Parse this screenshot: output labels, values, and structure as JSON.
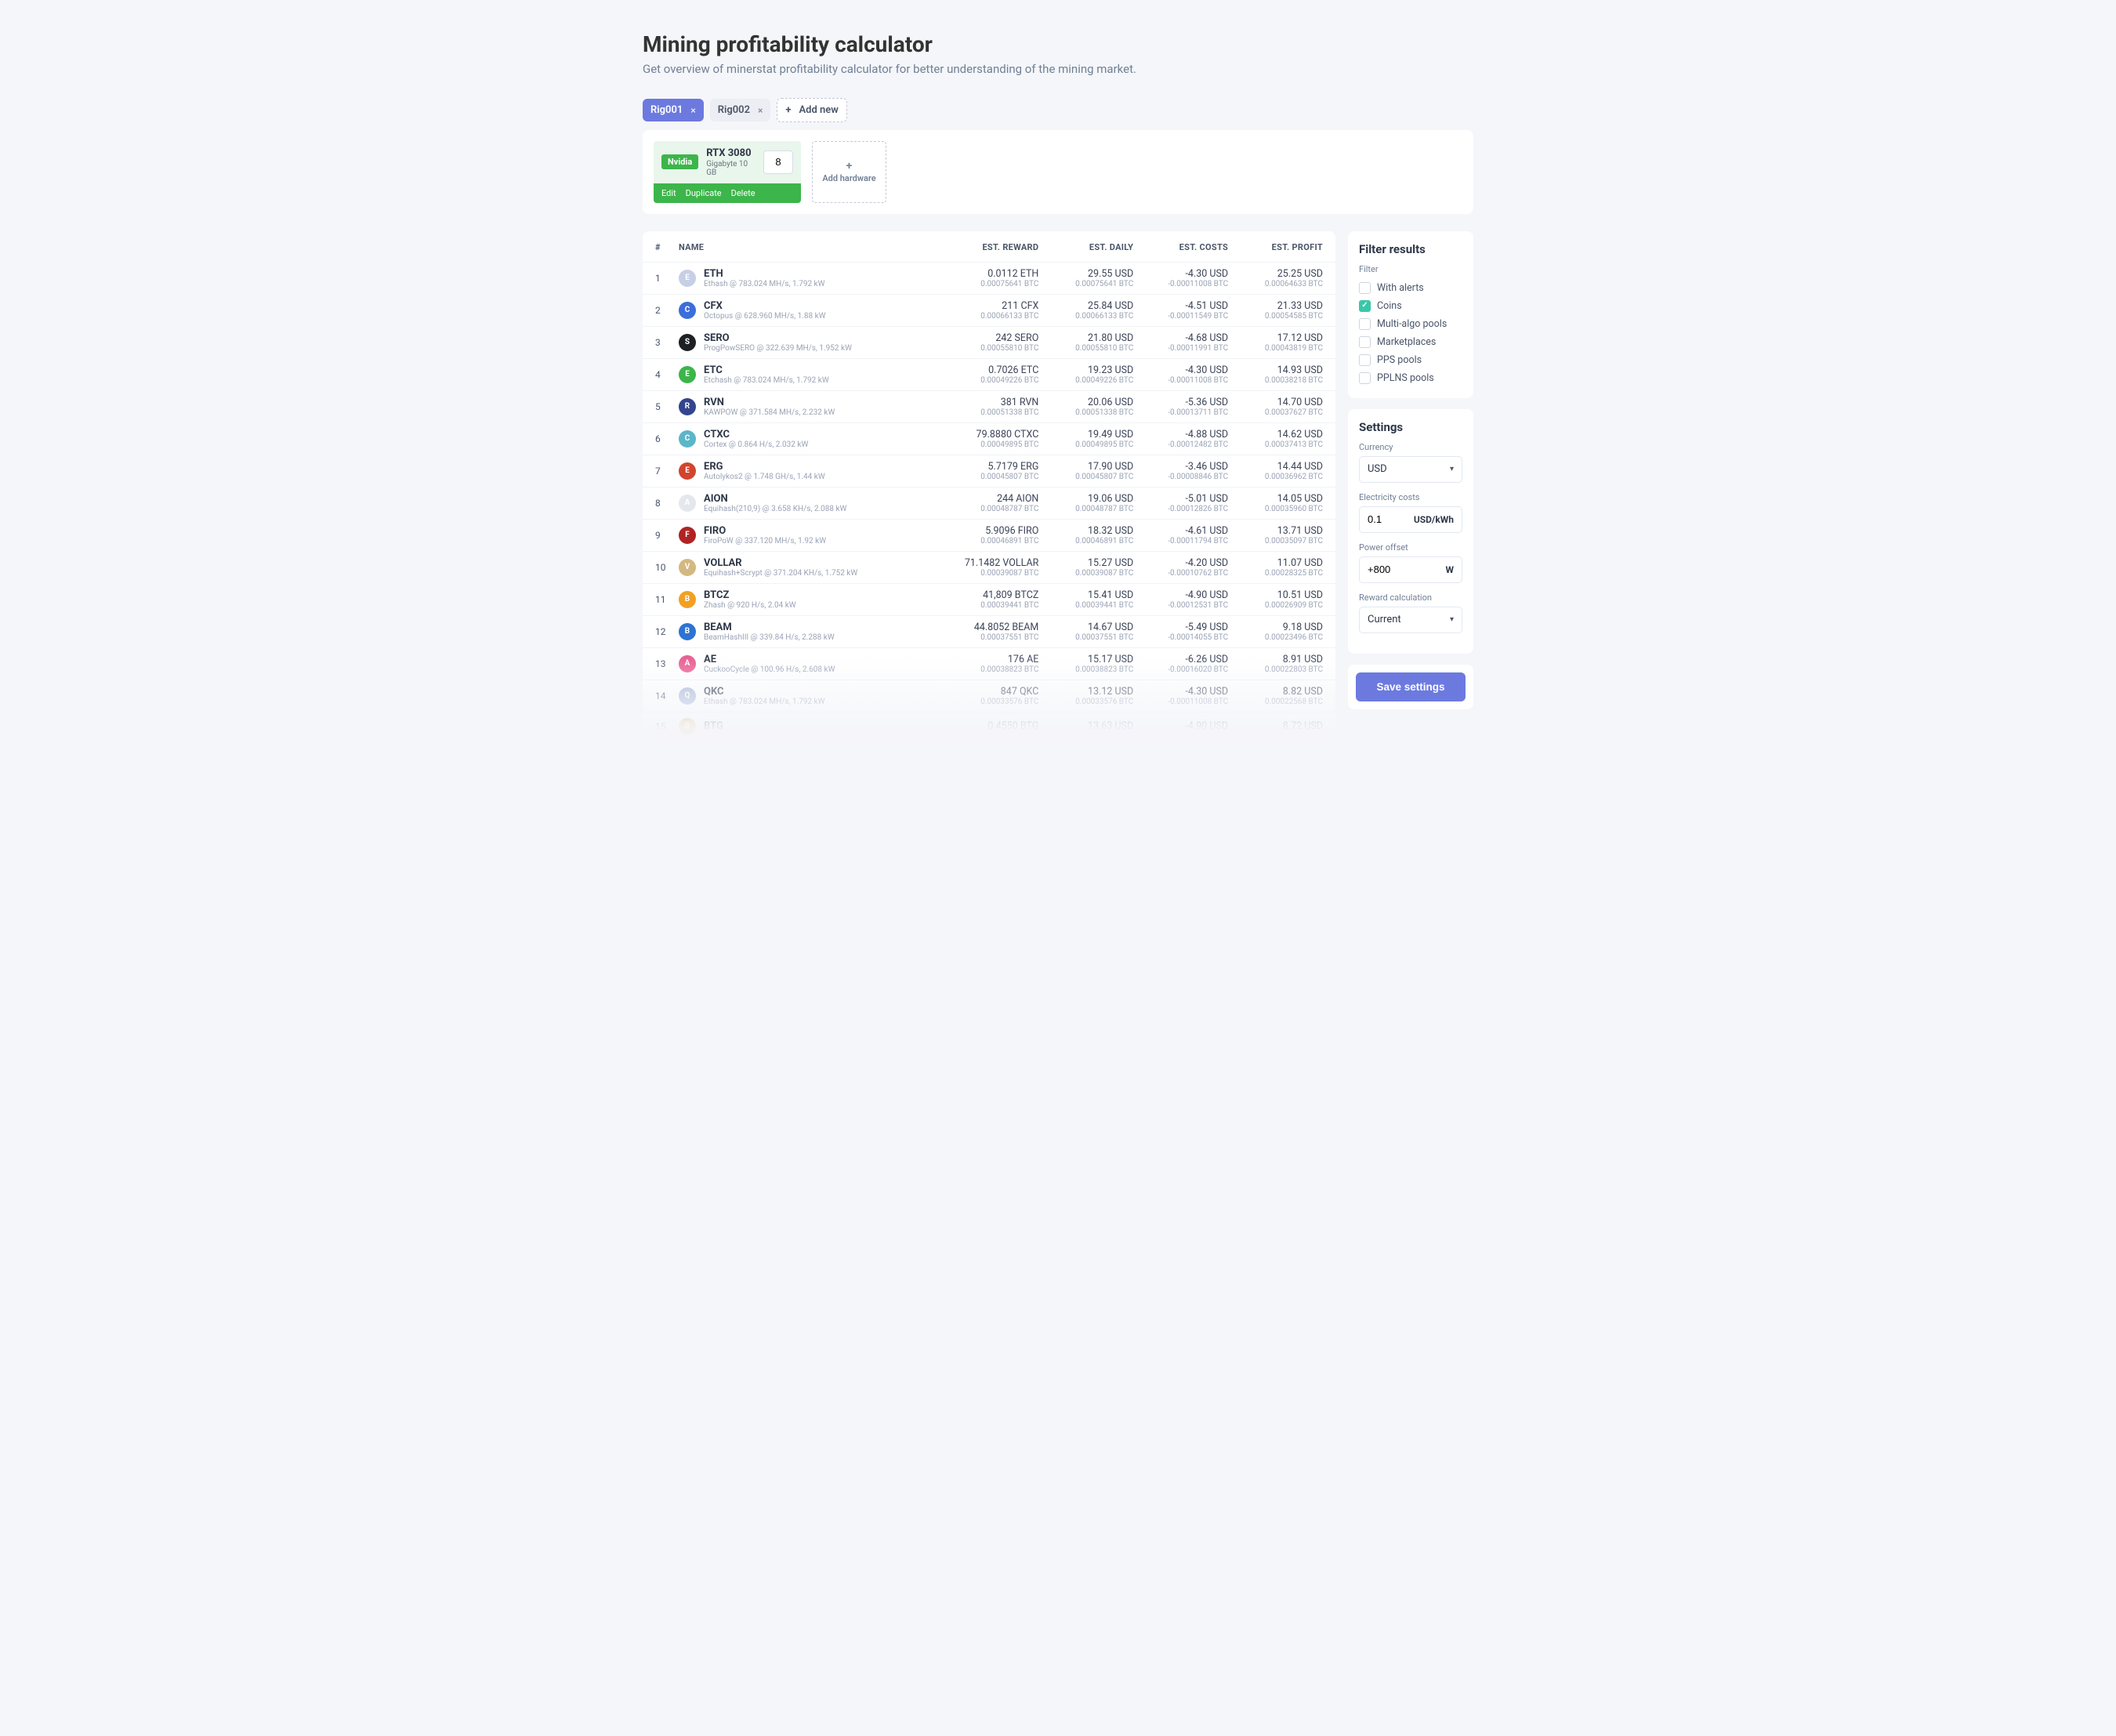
{
  "page": {
    "title": "Mining profitability calculator",
    "subtitle": "Get overview of minerstat profitability calculator for better understanding of the mining market."
  },
  "rigs": {
    "items": [
      {
        "label": "Rig001",
        "active": true
      },
      {
        "label": "Rig002",
        "active": false
      }
    ],
    "add_label": "Add new"
  },
  "hardware": {
    "card": {
      "vendor": "Nvidia",
      "model": "RTX 3080",
      "variant": "Gigabyte 10 GB",
      "qty": "8",
      "actions": {
        "edit": "Edit",
        "duplicate": "Duplicate",
        "delete": "Delete"
      }
    },
    "add_label": "Add hardware"
  },
  "table": {
    "headers": {
      "idx": "#",
      "name": "NAME",
      "reward": "EST. REWARD",
      "daily": "EST. DAILY",
      "costs": "EST. COSTS",
      "profit": "EST. PROFIT"
    },
    "rows": [
      {
        "idx": "1",
        "sym": "ETH",
        "algo": "Ethash @ 783.024 MH/s, 1.792 kW",
        "color": "#c6cfe6",
        "reward": "0.0112 ETH",
        "reward_sub": "0.00075641 BTC",
        "daily": "29.55 USD",
        "daily_sub": "0.00075641 BTC",
        "costs": "-4.30 USD",
        "costs_sub": "-0.00011008 BTC",
        "profit": "25.25 USD",
        "profit_sub": "0.00064633 BTC"
      },
      {
        "idx": "2",
        "sym": "CFX",
        "algo": "Octopus @ 628.960 MH/s, 1.88 kW",
        "color": "#3c6edb",
        "reward": "211 CFX",
        "reward_sub": "0.00066133 BTC",
        "daily": "25.84 USD",
        "daily_sub": "0.00066133 BTC",
        "costs": "-4.51 USD",
        "costs_sub": "-0.00011549 BTC",
        "profit": "21.33 USD",
        "profit_sub": "0.00054585 BTC"
      },
      {
        "idx": "3",
        "sym": "SERO",
        "algo": "ProgPowSERO @ 322.639 MH/s, 1.952 kW",
        "color": "#1f2024",
        "reward": "242 SERO",
        "reward_sub": "0.00055810 BTC",
        "daily": "21.80 USD",
        "daily_sub": "0.00055810 BTC",
        "costs": "-4.68 USD",
        "costs_sub": "-0.00011991 BTC",
        "profit": "17.12 USD",
        "profit_sub": "0.00043819 BTC"
      },
      {
        "idx": "4",
        "sym": "ETC",
        "algo": "Etchash @ 783.024 MH/s, 1.792 kW",
        "color": "#3cb54a",
        "reward": "0.7026 ETC",
        "reward_sub": "0.00049226 BTC",
        "daily": "19.23 USD",
        "daily_sub": "0.00049226 BTC",
        "costs": "-4.30 USD",
        "costs_sub": "-0.00011008 BTC",
        "profit": "14.93 USD",
        "profit_sub": "0.00038218 BTC"
      },
      {
        "idx": "5",
        "sym": "RVN",
        "algo": "KAWPOW @ 371.584 MH/s, 2.232 kW",
        "color": "#33458e",
        "reward": "381 RVN",
        "reward_sub": "0.00051338 BTC",
        "daily": "20.06 USD",
        "daily_sub": "0.00051338 BTC",
        "costs": "-5.36 USD",
        "costs_sub": "-0.00013711 BTC",
        "profit": "14.70 USD",
        "profit_sub": "0.00037627 BTC"
      },
      {
        "idx": "6",
        "sym": "CTXC",
        "algo": "Cortex @ 0.864 H/s, 2.032 kW",
        "color": "#5bb6c8",
        "reward": "79.8880 CTXC",
        "reward_sub": "0.00049895 BTC",
        "daily": "19.49 USD",
        "daily_sub": "0.00049895 BTC",
        "costs": "-4.88 USD",
        "costs_sub": "-0.00012482 BTC",
        "profit": "14.62 USD",
        "profit_sub": "0.00037413 BTC"
      },
      {
        "idx": "7",
        "sym": "ERG",
        "algo": "Autolykos2 @ 1.748 GH/s, 1.44 kW",
        "color": "#d1452e",
        "reward": "5.7179 ERG",
        "reward_sub": "0.00045807 BTC",
        "daily": "17.90 USD",
        "daily_sub": "0.00045807 BTC",
        "costs": "-3.46 USD",
        "costs_sub": "-0.00008846 BTC",
        "profit": "14.44 USD",
        "profit_sub": "0.00036962 BTC"
      },
      {
        "idx": "8",
        "sym": "AION",
        "algo": "Equihash(210,9) @ 3.658 KH/s, 2.088 kW",
        "color": "#e5e7ec",
        "reward": "244 AION",
        "reward_sub": "0.00048787 BTC",
        "daily": "19.06 USD",
        "daily_sub": "0.00048787 BTC",
        "costs": "-5.01 USD",
        "costs_sub": "-0.00012826 BTC",
        "profit": "14.05 USD",
        "profit_sub": "0.00035960 BTC"
      },
      {
        "idx": "9",
        "sym": "FIRO",
        "algo": "FiroPoW @ 337.120 MH/s, 1.92 kW",
        "color": "#b02323",
        "reward": "5.9096 FIRO",
        "reward_sub": "0.00046891 BTC",
        "daily": "18.32 USD",
        "daily_sub": "0.00046891 BTC",
        "costs": "-4.61 USD",
        "costs_sub": "-0.00011794 BTC",
        "profit": "13.71 USD",
        "profit_sub": "0.00035097 BTC"
      },
      {
        "idx": "10",
        "sym": "VOLLAR",
        "algo": "Equihash+Scrypt @ 371.204 KH/s, 1.752 kW",
        "color": "#d4b882",
        "reward": "71.1482 VOLLAR",
        "reward_sub": "0.00039087 BTC",
        "daily": "15.27 USD",
        "daily_sub": "0.00039087 BTC",
        "costs": "-4.20 USD",
        "costs_sub": "-0.00010762 BTC",
        "profit": "11.07 USD",
        "profit_sub": "0.00028325 BTC"
      },
      {
        "idx": "11",
        "sym": "BTCZ",
        "algo": "Zhash @ 920 H/s, 2.04 kW",
        "color": "#f2a024",
        "reward": "41,809 BTCZ",
        "reward_sub": "0.00039441 BTC",
        "daily": "15.41 USD",
        "daily_sub": "0.00039441 BTC",
        "costs": "-4.90 USD",
        "costs_sub": "-0.00012531 BTC",
        "profit": "10.51 USD",
        "profit_sub": "0.00026909 BTC"
      },
      {
        "idx": "12",
        "sym": "BEAM",
        "algo": "BeamHashIII @ 339.84 H/s, 2.288 kW",
        "color": "#2d73d4",
        "reward": "44.8052 BEAM",
        "reward_sub": "0.00037551 BTC",
        "daily": "14.67 USD",
        "daily_sub": "0.00037551 BTC",
        "costs": "-5.49 USD",
        "costs_sub": "-0.00014055 BTC",
        "profit": "9.18 USD",
        "profit_sub": "0.00023496 BTC"
      },
      {
        "idx": "13",
        "sym": "AE",
        "algo": "CuckooCycle @ 100.96 H/s, 2.608 kW",
        "color": "#e85b90",
        "reward": "176 AE",
        "reward_sub": "0.00038823 BTC",
        "daily": "15.17 USD",
        "daily_sub": "0.00038823 BTC",
        "costs": "-6.26 USD",
        "costs_sub": "-0.00016020 BTC",
        "profit": "8.91 USD",
        "profit_sub": "0.00022803 BTC"
      },
      {
        "idx": "14",
        "sym": "QKC",
        "algo": "Ethash @ 783.024 MH/s, 1.792 kW",
        "color": "#a8b5d6",
        "reward": "847 QKC",
        "reward_sub": "0.00033576 BTC",
        "daily": "13.12 USD",
        "daily_sub": "0.00033576 BTC",
        "costs": "-4.30 USD",
        "costs_sub": "-0.00011008 BTC",
        "profit": "8.82 USD",
        "profit_sub": "0.00022568 BTC"
      },
      {
        "idx": "15",
        "sym": "BTG",
        "algo": "",
        "color": "#d9a94b",
        "reward": "0.4550 BTG",
        "reward_sub": "",
        "daily": "13.63 USD",
        "daily_sub": "",
        "costs": "-4.90 USD",
        "costs_sub": "",
        "profit": "8.72 USD",
        "profit_sub": ""
      }
    ]
  },
  "filters": {
    "title": "Filter results",
    "label": "Filter",
    "options": [
      {
        "label": "With alerts",
        "checked": false
      },
      {
        "label": "Coins",
        "checked": true
      },
      {
        "label": "Multi-algo pools",
        "checked": false
      },
      {
        "label": "Marketplaces",
        "checked": false
      },
      {
        "label": "PPS pools",
        "checked": false
      },
      {
        "label": "PPLNS pools",
        "checked": false
      }
    ]
  },
  "settings": {
    "title": "Settings",
    "currency": {
      "label": "Currency",
      "value": "USD"
    },
    "elec": {
      "label": "Electricity costs",
      "value": "0.1",
      "unit": "USD/kWh"
    },
    "power": {
      "label": "Power offset",
      "value": "+800",
      "unit": "W"
    },
    "reward": {
      "label": "Reward calculation",
      "value": "Current"
    },
    "save_label": "Save settings"
  }
}
